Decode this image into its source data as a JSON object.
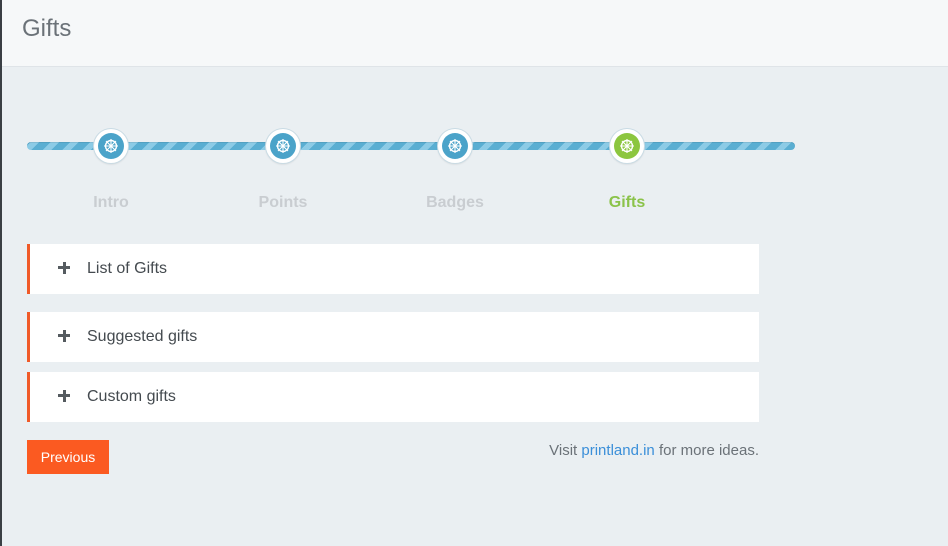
{
  "header": {
    "title": "Gifts"
  },
  "wizard": {
    "steps": [
      {
        "label": "Intro",
        "state": "completed"
      },
      {
        "label": "Points",
        "state": "completed"
      },
      {
        "label": "Badges",
        "state": "completed"
      },
      {
        "label": "Gifts",
        "state": "active"
      }
    ],
    "colors": {
      "track": "#5aaed2",
      "node": "#4ba3c9",
      "active_node": "#8cc63f",
      "active_label": "#8bc34a",
      "inactive_label": "#c9cdd1"
    },
    "step_icon": "dharma-wheel-icon"
  },
  "accordion": {
    "accent_color": "#f05a28",
    "expand_icon": "plus-icon",
    "panels": [
      {
        "title": "List of Gifts"
      },
      {
        "title": "Suggested gifts"
      },
      {
        "title": "Custom gifts"
      }
    ]
  },
  "footer": {
    "previous_label": "Previous",
    "previous_color": "#fb5a21",
    "visit_prefix": "Visit",
    "visit_link": "printland.in",
    "visit_suffix": "for more ideas."
  }
}
